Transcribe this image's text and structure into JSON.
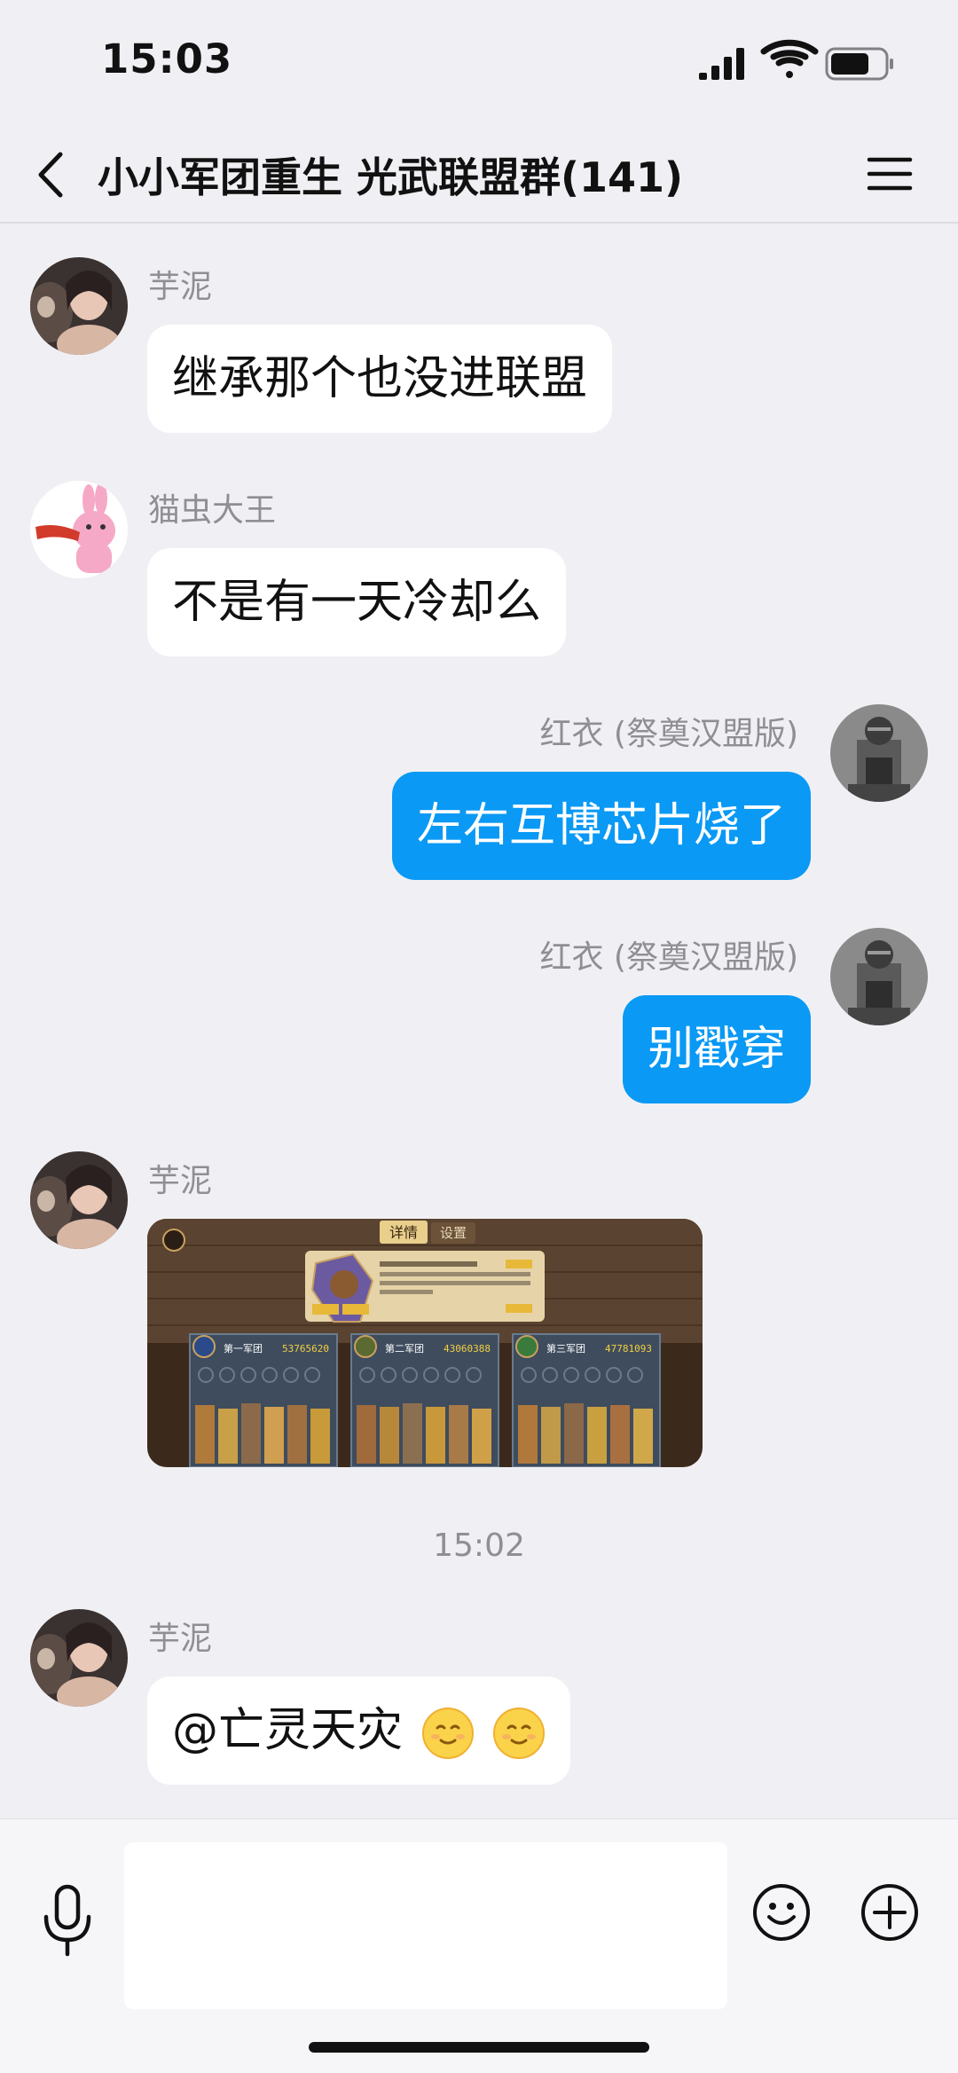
{
  "status": {
    "time": "15:03"
  },
  "header": {
    "title": "小小军团重生 光武联盟群(141)"
  },
  "messages": [
    {
      "sender": "芋泥",
      "text": "继承那个也没进联盟"
    },
    {
      "sender": "猫虫大王",
      "text": "不是有一天冷却么"
    },
    {
      "sender": "红衣 (祭奠汉盟版)",
      "text": "左右互博芯片烧了"
    },
    {
      "sender": "红衣 (祭奠汉盟版)",
      "text": "别戳穿"
    },
    {
      "sender": "芋泥"
    },
    {
      "sender": "芋泥",
      "text": "@亡灵天灾"
    }
  ],
  "game_screenshot": {
    "tab_active": "详情",
    "tab_other": "设置",
    "corps": [
      {
        "label": "第一军团",
        "power": "53765620"
      },
      {
        "label": "第二军团",
        "power": "43060388"
      },
      {
        "label": "第三军团",
        "power": "47781093"
      }
    ]
  },
  "time_divider": "15:02",
  "colors": {
    "accent": "#0a99f5",
    "background": "#f0f0f4",
    "incoming_bubble": "#ffffff"
  },
  "icons": [
    "back-icon",
    "menu-icon",
    "voice-icon",
    "emoji-icon",
    "plus-icon"
  ]
}
